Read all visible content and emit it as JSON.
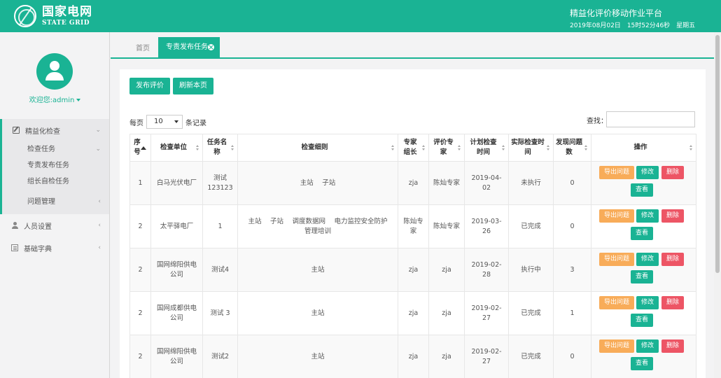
{
  "header": {
    "logo_cn": "国家电网",
    "logo_en": "STATE GRID",
    "platform_title": "精益化评价移动作业平台",
    "date": "2019年08月02日",
    "time": "15时52分46秒",
    "weekday": "星期五"
  },
  "sidebar": {
    "welcome": "欢迎您:admin",
    "menu": {
      "lean_check": "精益化检查",
      "check_task": "检查任务",
      "expert_publish": "专责发布任务",
      "leader_selfcheck": "组长自检任务",
      "issue_mgmt": "问题管理",
      "user_settings": "人员设置",
      "basic_dict": "基础字典"
    }
  },
  "tabs": {
    "home": "首页",
    "active": "专责发布任务"
  },
  "toolbar": {
    "publish": "发布评价",
    "refresh": "刷新本页"
  },
  "table_controls": {
    "per_page_prefix": "每页",
    "per_page_value": "10",
    "per_page_suffix": "条记录",
    "search_label": "查找："
  },
  "table": {
    "headers": [
      "序号",
      "检查单位",
      "任务名称",
      "检查细则",
      "专家组长",
      "评价专家",
      "计划检查时间",
      "实际检查时间",
      "发现问题数",
      "操作"
    ],
    "actions": {
      "export": "导出问题",
      "edit": "修改",
      "delete": "删除",
      "view": "查看"
    },
    "rows": [
      {
        "no": "1",
        "unit": "白马光伏电厂",
        "task": "测试123123",
        "detail": "主站　 子站",
        "leader": "zja",
        "expert": "陈灿专家",
        "plan": "2019-04-02",
        "actual": "未执行",
        "issues": "0"
      },
      {
        "no": "2",
        "unit": "太平驿电厂",
        "task": "1",
        "detail": "主站　 子站　 调度数据网　 电力监控安全防护　 管理培训",
        "leader": "陈灿专家",
        "expert": "陈灿专家",
        "plan": "2019-03-26",
        "actual": "已完成",
        "issues": "0"
      },
      {
        "no": "2",
        "unit": "国网绵阳供电公司",
        "task": "测试4",
        "detail": "主站",
        "leader": "zja",
        "expert": "zja",
        "plan": "2019-02-28",
        "actual": "执行中",
        "issues": "3"
      },
      {
        "no": "2",
        "unit": "国网成都供电公司",
        "task": "测试 3",
        "detail": "主站",
        "leader": "zja",
        "expert": "zja",
        "plan": "2019-02-27",
        "actual": "已完成",
        "issues": "1"
      },
      {
        "no": "2",
        "unit": "国网绵阳供电公司",
        "task": "测试2",
        "detail": "主站",
        "leader": "zja",
        "expert": "zja",
        "plan": "2019-02-27",
        "actual": "已完成",
        "issues": "0"
      }
    ]
  },
  "colors": {
    "primary": "#1ab394",
    "warning": "#f8ac59",
    "danger": "#ed5565"
  }
}
